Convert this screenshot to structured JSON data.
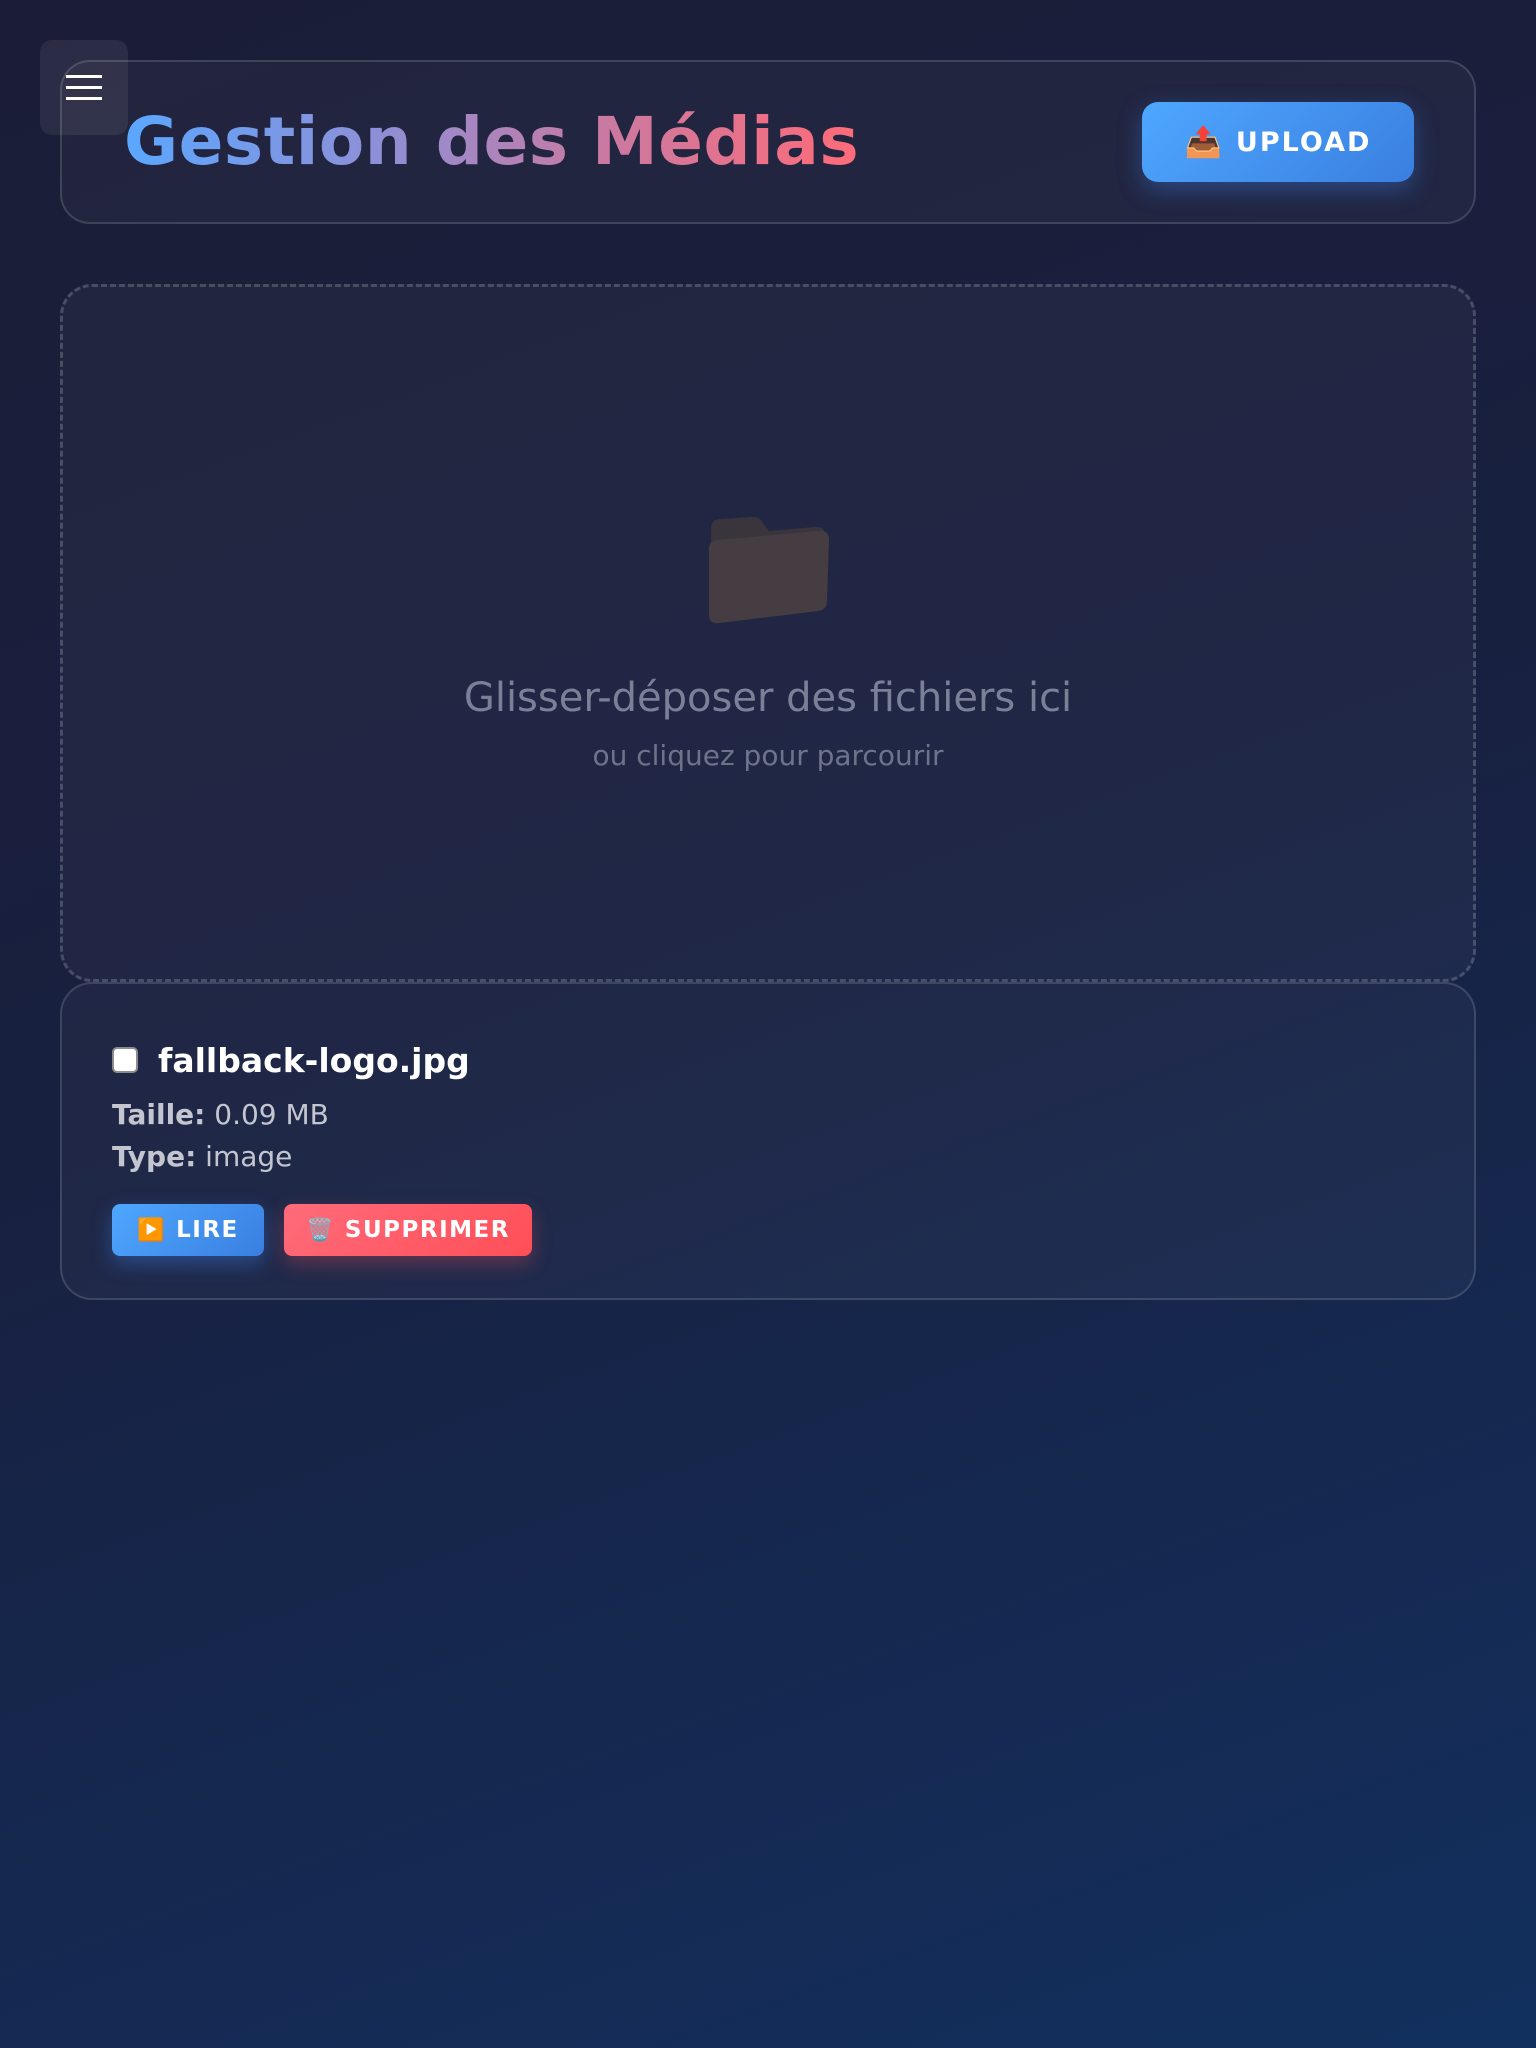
{
  "header": {
    "title": "Gestion des Médias",
    "upload_label": "UPLOAD",
    "upload_icon": "📤"
  },
  "dropzone": {
    "icon": "folder-icon",
    "title": "Glisser-déposer des fichiers ici",
    "subtitle": "ou cliquez pour parcourir"
  },
  "files": [
    {
      "name": "fallback-logo.jpg",
      "size_label": "Taille:",
      "size_value": "0.09 MB",
      "type_label": "Type:",
      "type_value": "image",
      "checked": false,
      "play_label": "LIRE",
      "play_icon": "▶️",
      "delete_label": "SUPPRIMER",
      "delete_icon": "🗑️"
    }
  ],
  "colors": {
    "accent_blue": "#4ea7ff",
    "accent_red": "#ff5a64",
    "title_gradient_start": "#5aa7ff",
    "title_gradient_end": "#ff6b78"
  }
}
